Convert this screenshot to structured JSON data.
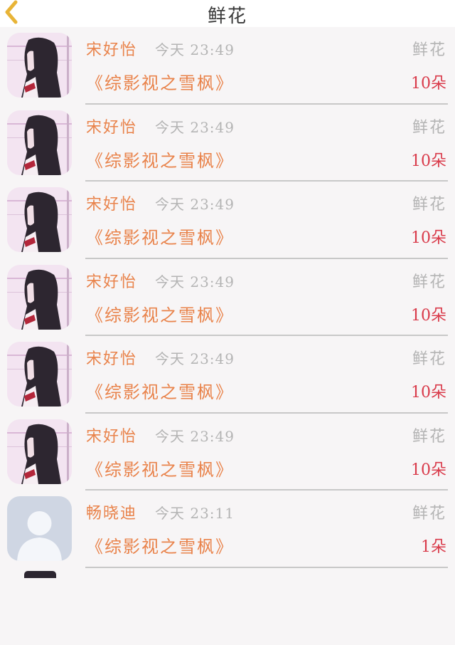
{
  "header": {
    "title": "鲜花"
  },
  "colors": {
    "accent": "#e9834b",
    "count": "#d93a4a",
    "muted": "#b4b4b4"
  },
  "rows": [
    {
      "name": "宋好怡",
      "time": "今天 23:49",
      "type": "鲜花",
      "work": "《综影视之雪枫》",
      "count": "10朵",
      "avatar": "photo"
    },
    {
      "name": "宋好怡",
      "time": "今天 23:49",
      "type": "鲜花",
      "work": "《综影视之雪枫》",
      "count": "10朵",
      "avatar": "photo"
    },
    {
      "name": "宋好怡",
      "time": "今天 23:49",
      "type": "鲜花",
      "work": "《综影视之雪枫》",
      "count": "10朵",
      "avatar": "photo"
    },
    {
      "name": "宋好怡",
      "time": "今天 23:49",
      "type": "鲜花",
      "work": "《综影视之雪枫》",
      "count": "10朵",
      "avatar": "photo"
    },
    {
      "name": "宋好怡",
      "time": "今天 23:49",
      "type": "鲜花",
      "work": "《综影视之雪枫》",
      "count": "10朵",
      "avatar": "photo"
    },
    {
      "name": "宋好怡",
      "time": "今天 23:49",
      "type": "鲜花",
      "work": "《综影视之雪枫》",
      "count": "10朵",
      "avatar": "photo"
    },
    {
      "name": "畅晓迪",
      "time": "今天 23:11",
      "type": "鲜花",
      "work": "《综影视之雪枫》",
      "count": "1朵",
      "avatar": "default"
    }
  ]
}
